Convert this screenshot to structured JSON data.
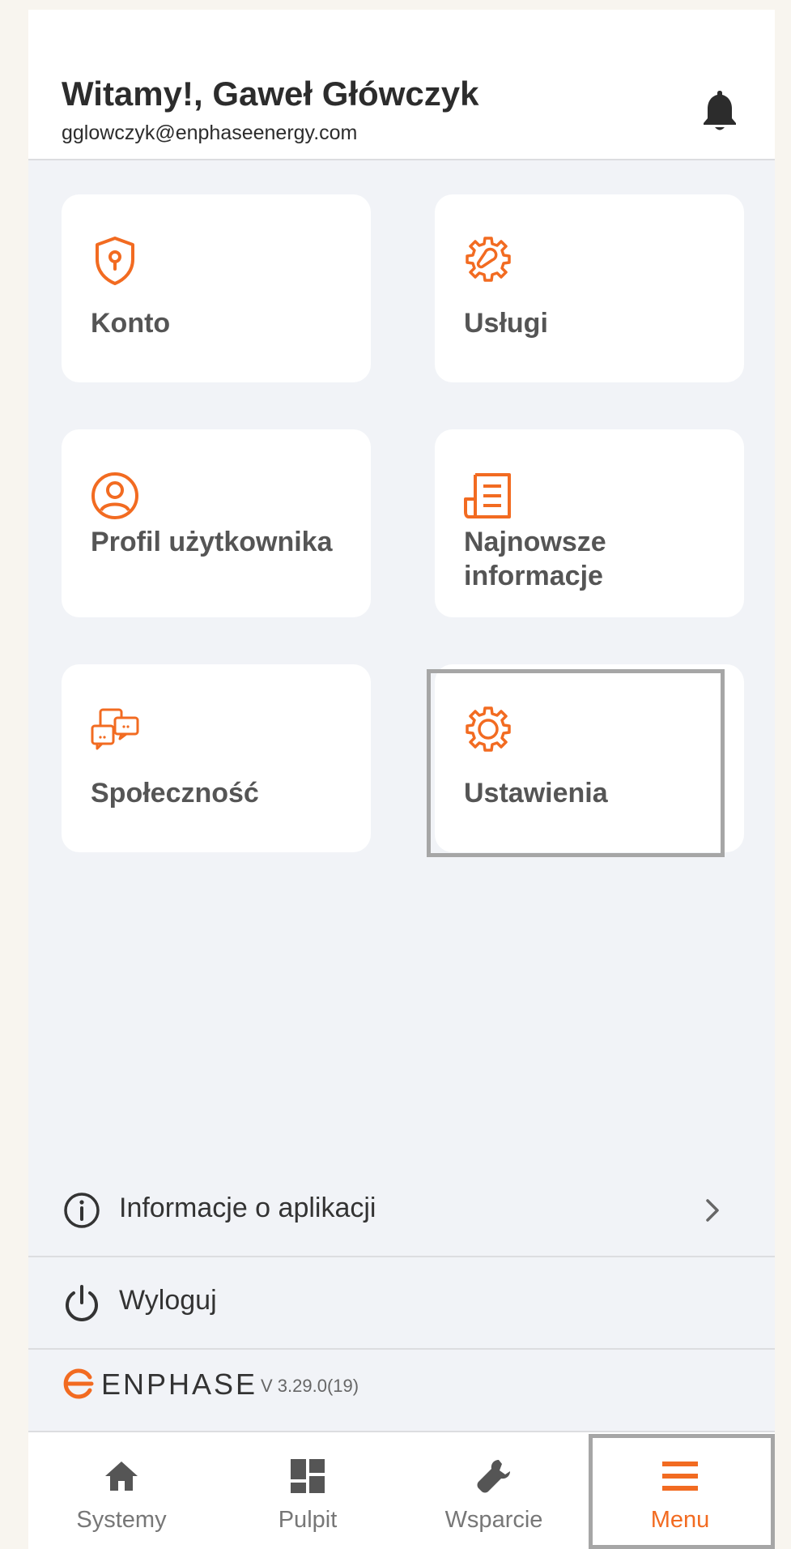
{
  "header": {
    "greeting": "Witamy!, Gaweł Główczyk",
    "email": "gglowczyk@enphaseenergy.com"
  },
  "tiles": [
    {
      "label": "Konto",
      "icon": "shield-lock-icon"
    },
    {
      "label": "Usługi",
      "icon": "gear-wrench-icon"
    },
    {
      "label": "Profil użytkownika",
      "icon": "user-profile-icon"
    },
    {
      "label": "Najnowsze informacje",
      "icon": "news-icon"
    },
    {
      "label": "Społeczność",
      "icon": "chat-bubbles-icon"
    },
    {
      "label": "Ustawienia",
      "icon": "gear-icon"
    }
  ],
  "rows": {
    "about": "Informacje o aplikacji",
    "logout": "Wyloguj"
  },
  "brand": {
    "name": "ENPHASE",
    "version": "V 3.29.0(19)"
  },
  "tabs": [
    {
      "label": "Systemy",
      "icon": "home-icon"
    },
    {
      "label": "Pulpit",
      "icon": "dashboard-icon"
    },
    {
      "label": "Wsparcie",
      "icon": "wrench-icon"
    },
    {
      "label": "Menu",
      "icon": "menu-icon",
      "active": true
    }
  ],
  "colors": {
    "accent": "#f26b21",
    "text": "#555555",
    "background": "#f1f3f7"
  }
}
